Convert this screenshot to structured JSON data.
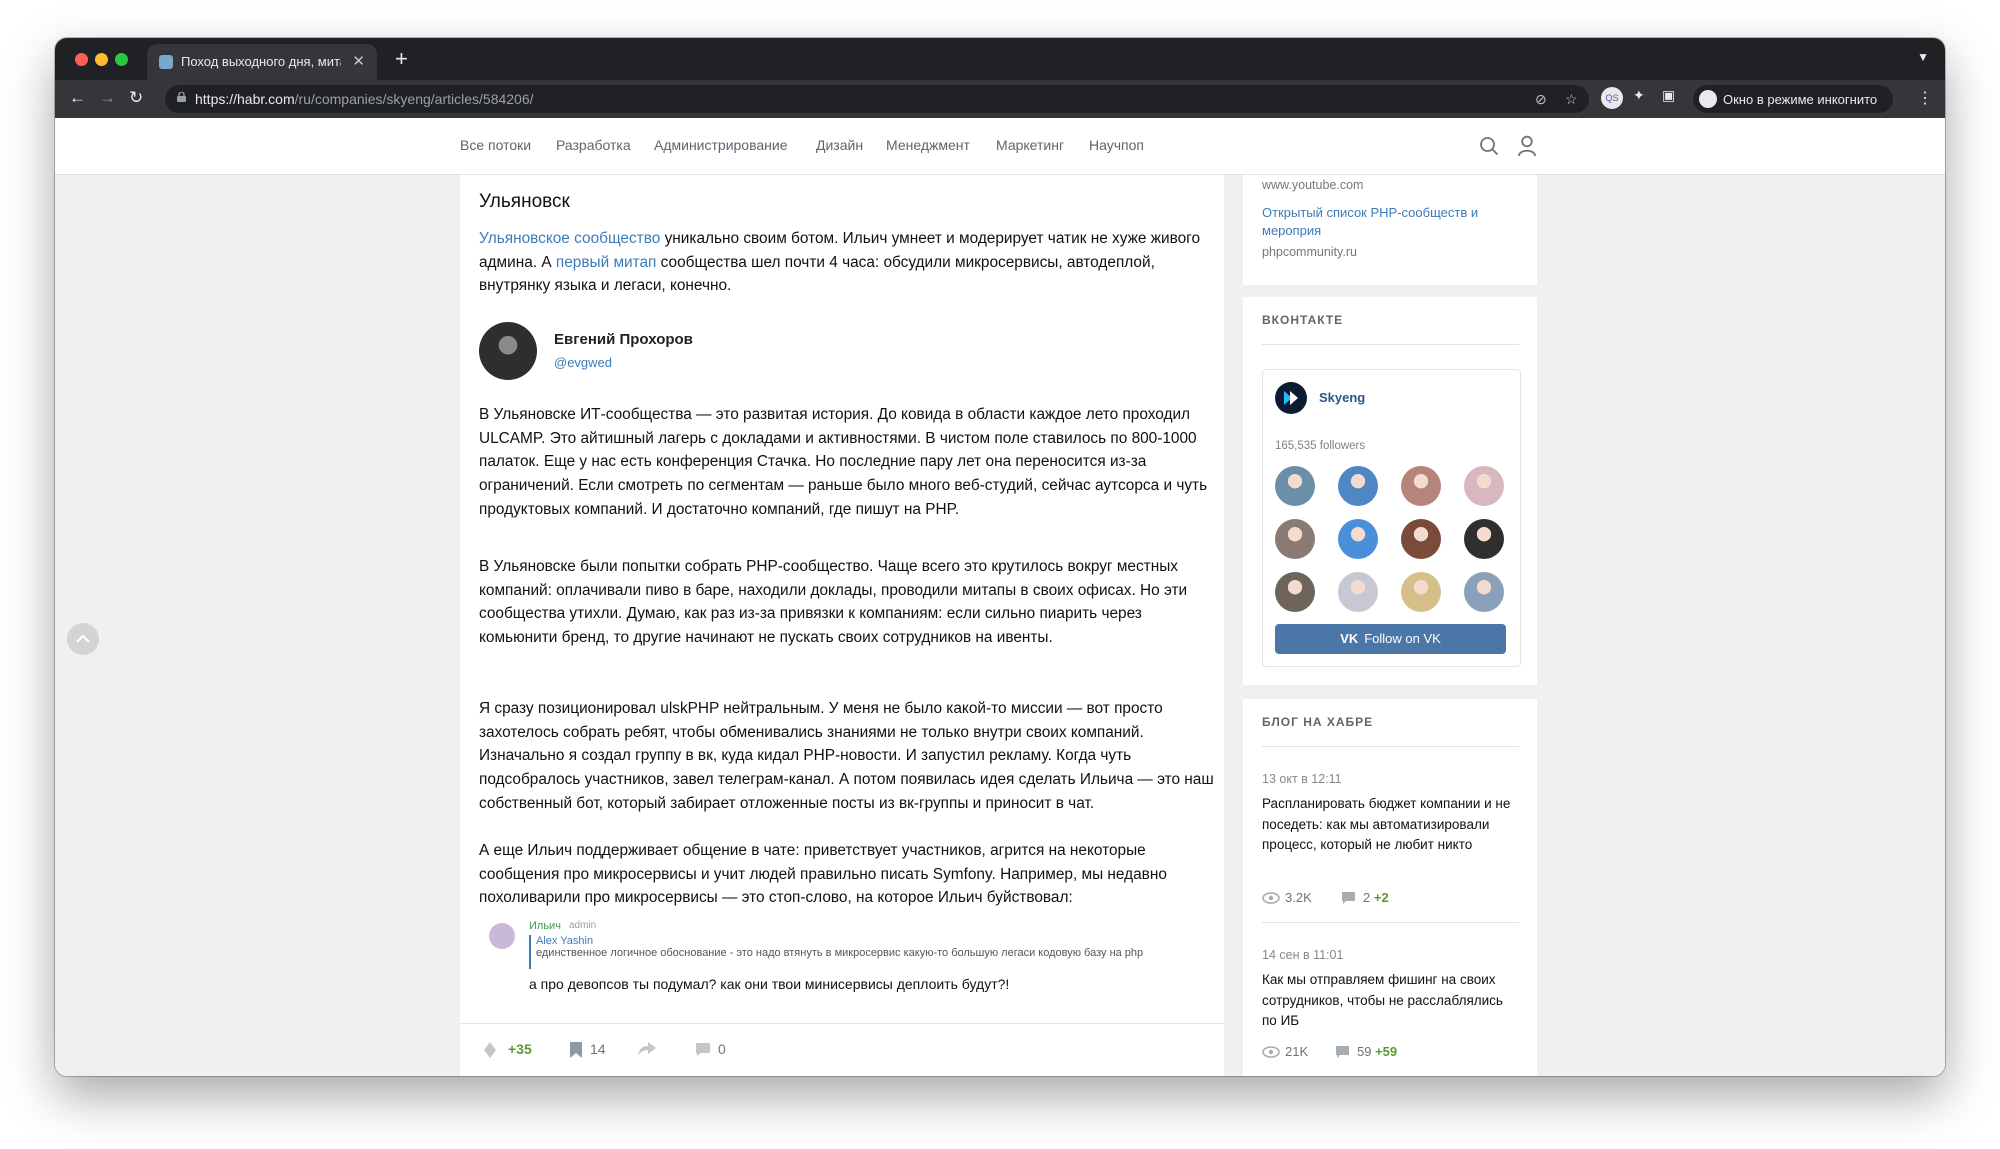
{
  "browser": {
    "tab_title": "Поход выходного дня, митап",
    "url_host": "https://habr.com",
    "url_path": "/ru/companies/skyeng/articles/584206/",
    "incognito_label": "Окно в режиме инкогнито",
    "profile_badge": "QS"
  },
  "site_nav": {
    "items": [
      "Все потоки",
      "Разработка",
      "Администрирование",
      "Дизайн",
      "Менеджмент",
      "Маркетинг",
      "Научпоп"
    ]
  },
  "article": {
    "heading": "Ульяновск",
    "intro": {
      "link1": "Ульяновское сообщество",
      "text1": " уникально своим ботом. Ильич умнеет и модерирует чатик не хуже живого админа. А ",
      "link2": "первый митап",
      "text2": " сообщества шел почти 4 часа: обсудили микросервисы, автодеплой, внутрянку языка и легаси, конечно."
    },
    "author": {
      "name": "Евгений Прохоров",
      "nick": "@evgwed"
    },
    "paragraphs": [
      "В Ульяновске ИТ-сообщества — это развитая история. До ковида в области каждое лето проходил ULCAMP. Это айтишный лагерь с докладами и активностями. В чистом поле ставилось по 800-1000 палаток. Еще у нас есть конференция Стачка. Но последние пару лет она переносится из-за ограничений. Если смотреть по сегментам — раньше было много веб-студий, сейчас аутсорса и чуть продуктовых компаний. И достаточно компаний, где пишут на PHP.",
      "В Ульяновске были попытки собрать PHP-сообщество. Чаще всего это крутилось вокруг местных компаний: оплачивали пиво в баре, находили доклады, проводили митапы в своих офисах. Но эти сообщества утихли. Думаю, как раз из-за привязки к компаниям: если сильно пиарить через комьюнити бренд, то другие начинают не пускать своих сотрудников на ивенты.",
      "Я сразу позиционировал ulskPHP нейтральным. У меня не было какой-то миссии — вот просто захотелось собрать ребят, чтобы обменивались знаниями не только внутри своих компаний. Изначально я создал группу в вк, куда кидал PHP-новости. И запустил рекламу. Когда чуть подсобралось участников, завел телеграм-канал. А потом появилась идея сделать Ильича — это наш собственный бот, который забирает отложенные посты из вк-группы и приносит в чат.",
      "А еще Ильич поддерживает общение в чате: приветствует участников, агрится на некоторые сообщения про микросервисы и учит людей правильно писать Symfony. Например, мы недавно похоливарили про микросервисы — это стоп-слово, на которое Ильич буйствовал:"
    ],
    "chat": {
      "name": "Ильич",
      "role": "admin",
      "quote_name": "Alex Yashin",
      "quote_text": "единственное логичное обоснование - это надо втянуть в микросервис какую-то большую легаси кодовую базу на php",
      "message": "а про девопсов ты подумал? как они твои минисервисы деплоить будут?!"
    },
    "footer": {
      "votes": "+35",
      "bookmarks": "14",
      "comments": "0"
    }
  },
  "sidebar": {
    "links": [
      {
        "muted_top": "www.youtube.com"
      },
      {
        "title": "Открытый список PHP-сообществ и мероприя",
        "domain": "phpcommunity.ru"
      }
    ],
    "vk": {
      "section_title": "ВКОНТАКТЕ",
      "group_name": "Skyeng",
      "followers": "165,535 followers",
      "follow_label": "Follow on VK",
      "avatar_colors": [
        "#6a8fa8",
        "#4f86c4",
        "#b5857a",
        "#d8b7bf",
        "#8b7a72",
        "#4a90d9",
        "#7a4a3a",
        "#2f2f2f",
        "#6e6458",
        "#c8c8d4",
        "#d6c08a",
        "#8aa0b8"
      ]
    },
    "blog": {
      "section_title": "БЛОГ НА ХАБРЕ",
      "posts": [
        {
          "date": "13 окт в 12:11",
          "title": "Распланировать бюджет компании и не поседеть: как мы автоматизировали процесс, который не любит никто",
          "views": "3.2K",
          "comments": "2",
          "comments_plus": "+2"
        },
        {
          "date": "14 сен в 11:01",
          "title": "Как мы отправляем фишинг на своих сотрудников, чтобы не расслаблялись по ИБ",
          "views": "21K",
          "comments": "59",
          "comments_plus": "+59"
        }
      ]
    }
  }
}
